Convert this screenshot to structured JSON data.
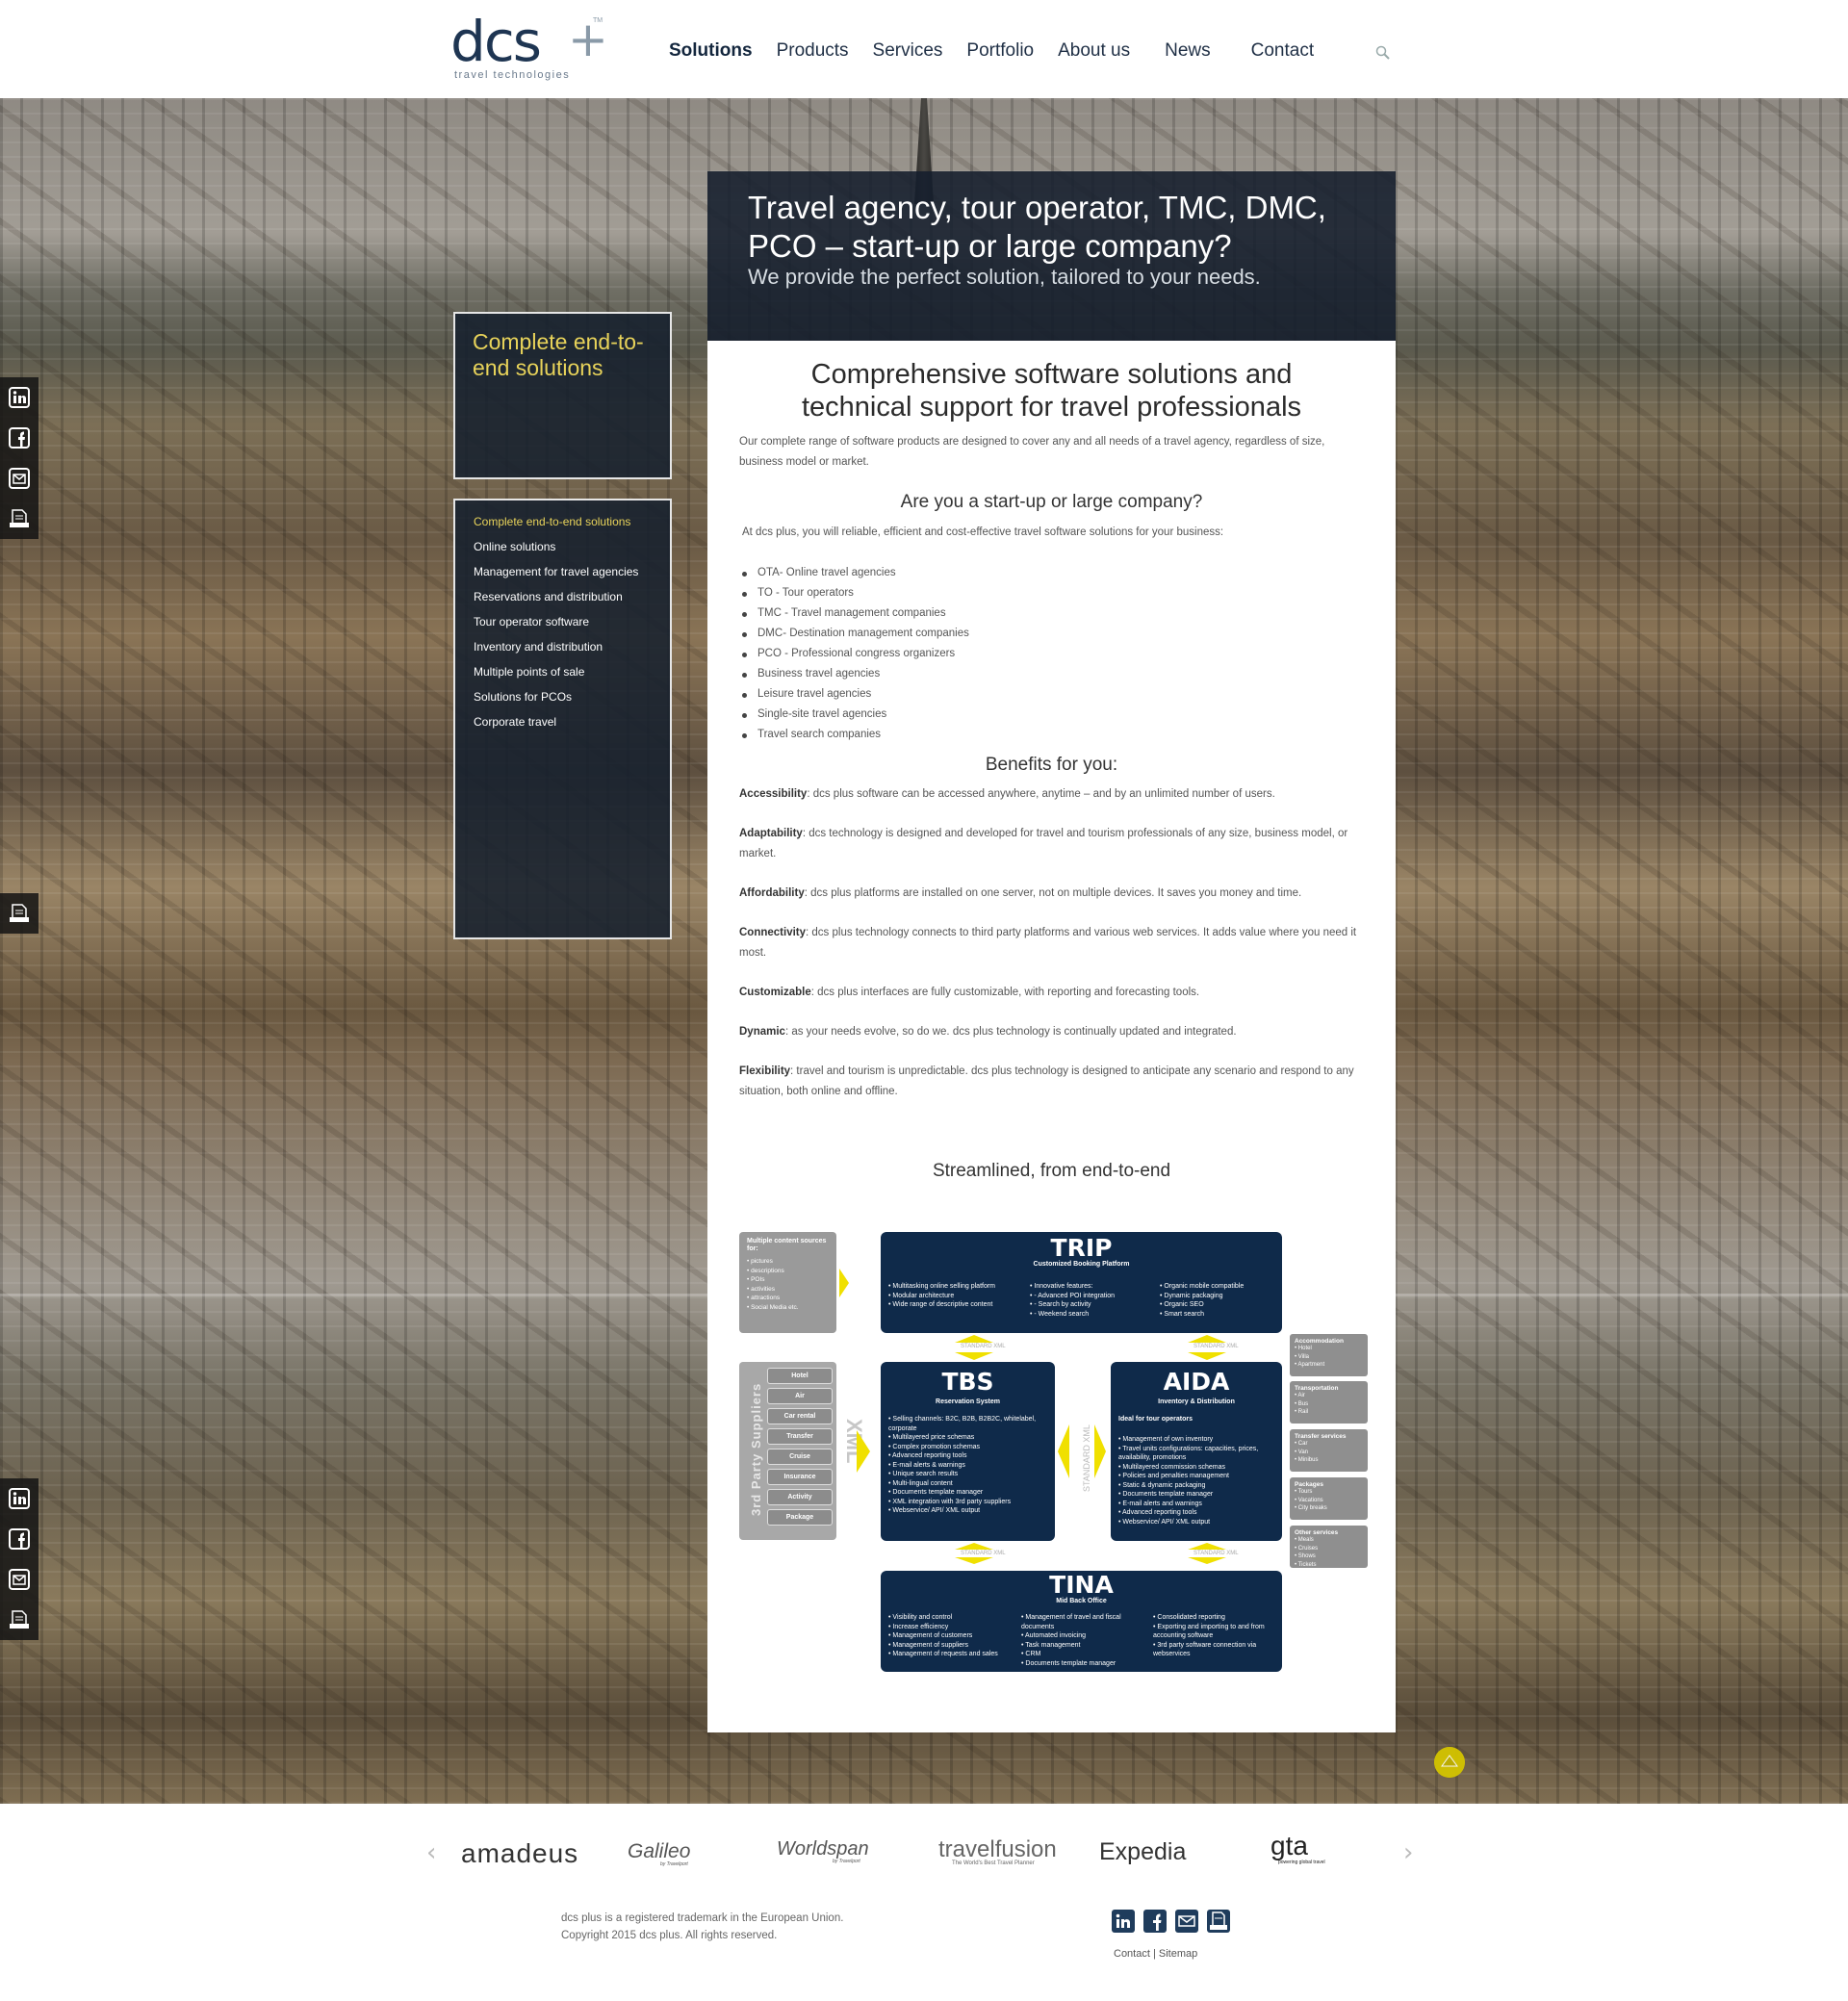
{
  "logo": {
    "main": "dcs",
    "sub": "travel technologies",
    "tm": "TM"
  },
  "nav": [
    {
      "label": "Solutions",
      "active": true
    },
    {
      "label": "Products"
    },
    {
      "label": "Services"
    },
    {
      "label": "Portfolio"
    },
    {
      "label": "About us"
    },
    {
      "label": "News"
    },
    {
      "label": "Contact"
    }
  ],
  "hero": {
    "title": "Travel agency, tour operator, TMC, DMC, PCO – start-up or large company?",
    "subtitle": "We provide the perfect solution, tailored to your needs."
  },
  "sidebar": {
    "title": "Complete end-to-end solutions",
    "items": [
      {
        "label": "Complete end-to-end solutions",
        "active": true
      },
      {
        "label": "Online solutions"
      },
      {
        "label": "Management for travel agencies"
      },
      {
        "label": "Reservations and distribution"
      },
      {
        "label": "Tour operator software"
      },
      {
        "label": "Inventory and distribution"
      },
      {
        "label": "Multiple points of sale"
      },
      {
        "label": "Solutions for PCOs"
      },
      {
        "label": "Corporate travel"
      }
    ]
  },
  "main": {
    "title": "Comprehensive software solutions and technical support for travel professionals",
    "intro": "Our complete range of software products are designed to cover any and all needs of a travel agency, regardless of size, business model or market.",
    "q_heading": "Are you a start-up or large company?",
    "q_text": "At dcs plus, you will reliable, efficient and cost-effective travel software solutions for your business:",
    "list": [
      "OTA- Online travel agencies",
      "TO - Tour operators",
      "TMC - Travel management companies",
      "DMC- Destination management companies",
      "PCO - Professional congress organizers",
      "Business travel agencies",
      "Leisure travel agencies",
      "Single-site travel agencies",
      "Travel search companies"
    ],
    "benefits_heading": "Benefits for you:",
    "benefits": [
      {
        "name": "Accessibility",
        "text": ": dcs plus software can be accessed anywhere, anytime – and by an unlimited number of users."
      },
      {
        "name": "Adaptability",
        "text": ": dcs technology is designed and developed for travel and tourism professionals of any size, business model, or market."
      },
      {
        "name": "Affordability",
        "text": ": dcs plus platforms are installed on one server, not on multiple devices. It saves you money and time."
      },
      {
        "name": "Connectivity",
        "text": ": dcs plus technology connects to third party platforms and various web services. It adds value where you need it most."
      },
      {
        "name": "Customizable",
        "text": ": dcs plus interfaces are fully customizable, with reporting and forecasting tools."
      },
      {
        "name": "Dynamic",
        "text": ": as your needs evolve, so do we. dcs plus technology is continually updated and integrated."
      },
      {
        "name": "Flexibility",
        "text": ": travel and tourism is unpredictable. dcs plus technology is designed to anticipate any scenario and respond to any situation, both online and offline."
      }
    ],
    "streamlined_heading": "Streamlined, from end-to-end"
  },
  "diagram": {
    "content_sources": {
      "heading": "Multiple content sources for:",
      "items": [
        "pictures",
        "descriptions",
        "POIs",
        "activities",
        "attractions",
        "Social Media etc."
      ]
    },
    "trip": {
      "title": "TRIP",
      "subtitle": "Customized Booking Platform",
      "col1": [
        "Multitasking online selling platform",
        "Modular architecture",
        "Wide range of descriptive content"
      ],
      "col2": [
        "Innovative features:",
        "- Advanced POI integration",
        "- Search by activity",
        "- Weekend search"
      ],
      "col3": [
        "Organic mobile compatible",
        "Dynamic packaging",
        "Organic SEO",
        "Smart search"
      ]
    },
    "tbs": {
      "title": "TBS",
      "subtitle": "Reservation System",
      "items": [
        "Selling channels: B2C, B2B, B2B2C, whitelabel, corporate",
        "Multilayered price schemas",
        "Complex promotion schemas",
        "Advanced reporting tools",
        "E-mail alerts & warnings",
        "Unique search results",
        "Multi-lingual content",
        "Documents template manager",
        "XML integration with 3rd party suppliers",
        "Webservice/ API/ XML output"
      ]
    },
    "aida": {
      "title": "AIDA",
      "subtitle": "Inventory & Distribution",
      "tagline": "Ideal for tour operators",
      "items": [
        "Management of own inventory",
        "Travel units configurations: capacities, prices, availability, promotions",
        "Multilayered commission schemas",
        "Policies and penalties management",
        "Static & dynamic packaging",
        "Documents template manager",
        "E-mail alerts and warnings",
        "Advanced reporting tools",
        "Webservice/ API/ XML output"
      ]
    },
    "tina": {
      "title": "TINA",
      "subtitle": "Mid Back Office",
      "col1": [
        "Visibility and control",
        "Increase efficiency",
        "Management of customers",
        "Management of suppliers",
        "Management of requests and sales"
      ],
      "col2": [
        "Management of travel and fiscal documents",
        "Automated invoicing",
        "Task management",
        "CRM",
        "Documents template manager"
      ],
      "col3": [
        "Consolidated reporting",
        "Exporting and importing to and from accounting software",
        "3rd party software connection via webservices"
      ]
    },
    "suppliers_label": "3rd Party Suppliers",
    "suppliers": [
      "Hotel",
      "Air",
      "Car rental",
      "Transfer",
      "Cruise",
      "Insurance",
      "Activity",
      "Package"
    ],
    "xml_label": "XML",
    "standard_xml": "STANDARD XML",
    "right": [
      {
        "heading": "Accommodation",
        "items": [
          "Hotel",
          "Villa",
          "Apartment"
        ]
      },
      {
        "heading": "Transportation",
        "items": [
          "Air",
          "Bus",
          "Rail"
        ]
      },
      {
        "heading": "Transfer services",
        "items": [
          "Car",
          "Van",
          "Minibus"
        ]
      },
      {
        "heading": "Packages",
        "items": [
          "Tours",
          "Vacations",
          "City breaks"
        ]
      },
      {
        "heading": "Other services",
        "items": [
          "Meals",
          "Cruises",
          "Shows",
          "Tickets"
        ]
      }
    ],
    "colors": {
      "box": "#0f2a4a",
      "grey": "#9a9a9a",
      "arrow": "#f0e000"
    }
  },
  "partners": [
    "amadeus",
    "Galileo",
    "Worldspan",
    "travelfusion",
    "Expedia",
    "gta"
  ],
  "partner_taglines": {
    "galileo": "by Travelport",
    "worldspan": "by Travelport",
    "travelfusion": "The World's Best Travel Planner",
    "gta": "powering global travel"
  },
  "footer": {
    "line1": "dcs plus is a registered trademark in the European Union.",
    "line2": "Copyright 2015 dcs plus. All rights reserved.",
    "links": [
      "Contact",
      "Sitemap"
    ]
  },
  "icons": {
    "search": "search-icon",
    "linkedin": "linkedin-icon",
    "facebook": "facebook-icon",
    "mail": "mail-icon",
    "newsletter": "newsletter-icon",
    "prev": "chevron-left-icon",
    "next": "chevron-right-icon",
    "top": "arrow-up-icon"
  },
  "colors": {
    "accent": "#e8d35a",
    "navy": "#1e3552",
    "panel": "#16202e"
  }
}
